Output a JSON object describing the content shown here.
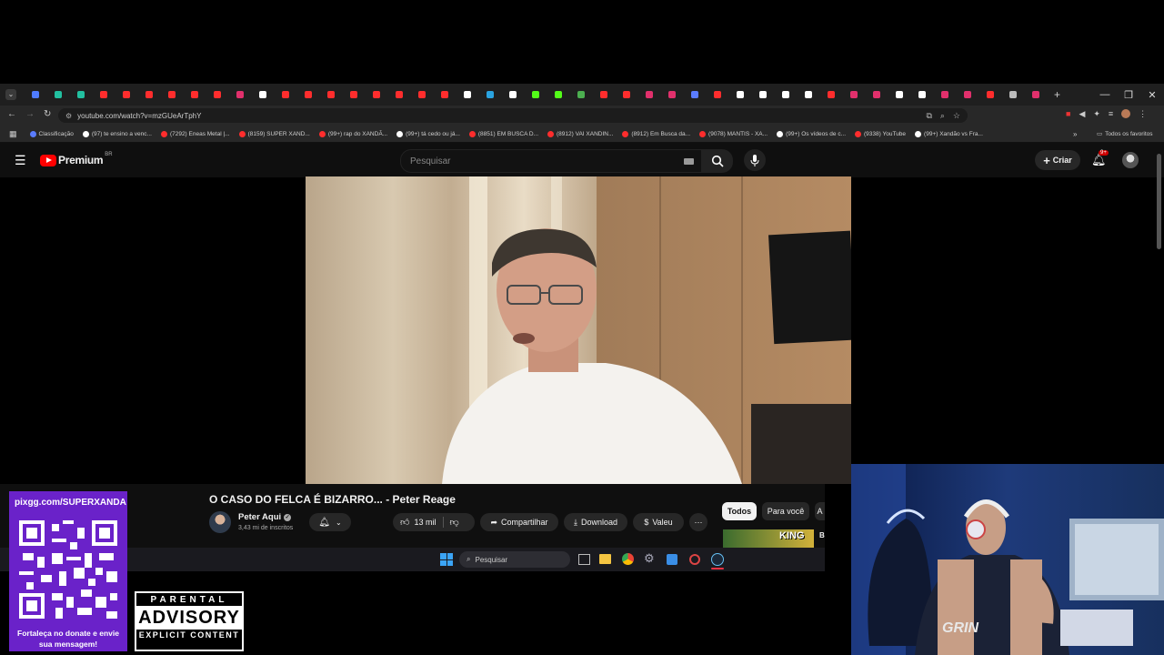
{
  "browser": {
    "url": "youtube.com/watch?v=mzGUeArTphY",
    "tab_colors": [
      "#4f7cff",
      "#22c0a0",
      "#22c0a0",
      "#ff2d2d",
      "#ff2d2d",
      "#ff2d2d",
      "#ff2d2d",
      "#ff2d2d",
      "#ff2d2d",
      "#e1306c",
      "#ffffff",
      "#ff2d2d",
      "#ff2d2d",
      "#ff2d2d",
      "#ff2d2d",
      "#ff2d2d",
      "#ff2d2d",
      "#ff2d2d",
      "#ff2d2d",
      "#ffffff",
      "#2aa3e0",
      "#ffffff",
      "#53fc18",
      "#53fc18",
      "#4caf50",
      "#ff2d2d",
      "#ff2d2d",
      "#e1306c",
      "#e1306c",
      "#5a7cff",
      "#ff2d2d",
      "#ffffff",
      "#ffffff",
      "#ffffff",
      "#ffffff",
      "#ff2d2d",
      "#e1306c",
      "#e1306c",
      "#ffffff",
      "#ffffff",
      "#e1306c",
      "#e1306c",
      "#ff2d2d",
      "#bbbbbb",
      "#e1306c"
    ],
    "new_tab_glyph": "+",
    "bookmarks": [
      {
        "label": "Classificação",
        "color": "#5a7cff"
      },
      {
        "label": "(97) te ensino a venc...",
        "color": "#ffffff"
      },
      {
        "label": "(7292) Eneas Metal |...",
        "color": "#ff2d2d"
      },
      {
        "label": "(8159) SUPER XAND...",
        "color": "#ff2d2d"
      },
      {
        "label": "(99+) rap do XANDÃ...",
        "color": "#ff2d2d"
      },
      {
        "label": "(99+) tá cedo ou já...",
        "color": "#ffffff"
      },
      {
        "label": "(8851) EM BUSCA D...",
        "color": "#ff2d2d"
      },
      {
        "label": "(8912) VAI XANDIN...",
        "color": "#ff2d2d"
      },
      {
        "label": "(8912) Em Busca da...",
        "color": "#ff2d2d"
      },
      {
        "label": "(9078) MANTIS - XA...",
        "color": "#ff2d2d"
      },
      {
        "label": "(99+) Os vídeos de c...",
        "color": "#ffffff"
      },
      {
        "label": "(9338) YouTube",
        "color": "#ff2d2d"
      },
      {
        "label": "(99+) Xandão vs Fra...",
        "color": "#ffffff"
      }
    ],
    "all_bookmarks": "Todos os favoritos"
  },
  "youtube": {
    "logo_text": "Premium",
    "logo_region": "BR",
    "search_placeholder": "Pesquisar",
    "create_label": "Criar",
    "notif_badge": "9+",
    "video_title": "O CASO DO FELCA É BIZARRO... - Peter Reage",
    "channel_name": "Peter Aqui",
    "subscribers": "3,43 mi de inscritos",
    "likes": "13 mil",
    "share_label": "Compartilhar",
    "download_label": "Download",
    "thanks_label": "Valeu",
    "chips": [
      "Todos",
      "Para você",
      "A"
    ],
    "suggested_thumb_text": "KING",
    "suggested_letter": "B"
  },
  "taskbar": {
    "search_placeholder": "Pesquisar"
  },
  "overlay": {
    "pix_url": "pixgg.com/SUPERXANDA",
    "donate_text": "Fortaleça no donate e envie sua mensagem!",
    "advisory_top": "PARENTAL",
    "advisory_main": "ADVISORY",
    "advisory_bottom": "EXPLICIT CONTENT"
  },
  "webcam": {
    "shirt_text": "GRIN"
  }
}
